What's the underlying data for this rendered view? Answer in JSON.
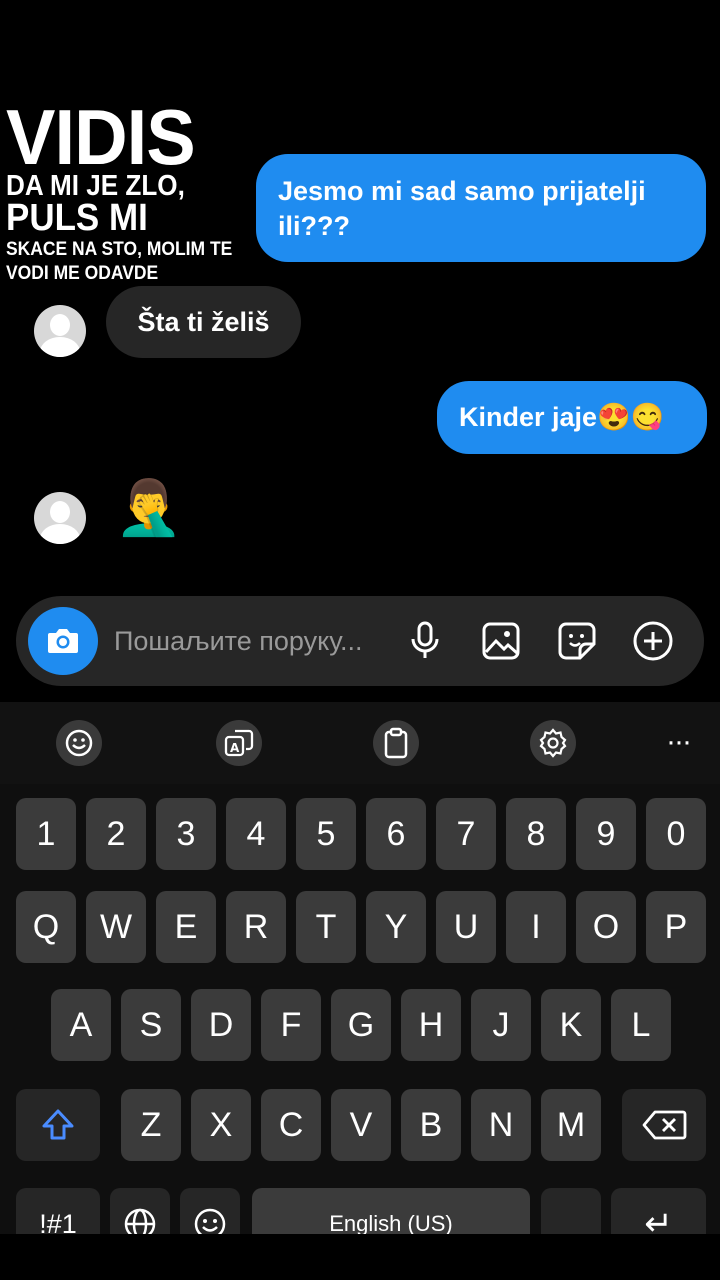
{
  "caption": {
    "line1": "VIDIS",
    "line2": "DA MI JE ZLO,",
    "line3": "PULS MI",
    "line4": "SKACE NA STO, MOLIM TE",
    "line5": "VODI ME ODAVDE"
  },
  "messages": [
    {
      "direction": "outgoing",
      "text": "Jesmo mi sad samo prijatelji ili???"
    },
    {
      "direction": "incoming",
      "text": "Šta ti želiš"
    },
    {
      "direction": "outgoing",
      "text": "Kinder jaje😍😋"
    },
    {
      "direction": "incoming",
      "text": "🤦‍♂️"
    }
  ],
  "composer": {
    "placeholder": "Пошаљите поруку...",
    "icons": [
      "camera-icon",
      "microphone-icon",
      "gallery-icon",
      "sticker-icon",
      "plus-icon"
    ],
    "accent_color": "#1f8cf0"
  },
  "keyboard_toolbar": {
    "icons": [
      "emoji-icon",
      "translate-icon",
      "clipboard-icon",
      "settings-icon",
      "more-icon"
    ],
    "more_label": "···"
  },
  "keyboard": {
    "number_row": [
      "1",
      "2",
      "3",
      "4",
      "5",
      "6",
      "7",
      "8",
      "9",
      "0"
    ],
    "row1": [
      "Q",
      "W",
      "E",
      "R",
      "T",
      "Y",
      "U",
      "I",
      "O",
      "P"
    ],
    "row2": [
      "A",
      "S",
      "D",
      "F",
      "G",
      "H",
      "J",
      "K",
      "L"
    ],
    "row3": [
      "Z",
      "X",
      "C",
      "V",
      "B",
      "N",
      "M"
    ],
    "symbols_label": "!#1",
    "space_label": "English (US)",
    "enter_label": "↵"
  }
}
